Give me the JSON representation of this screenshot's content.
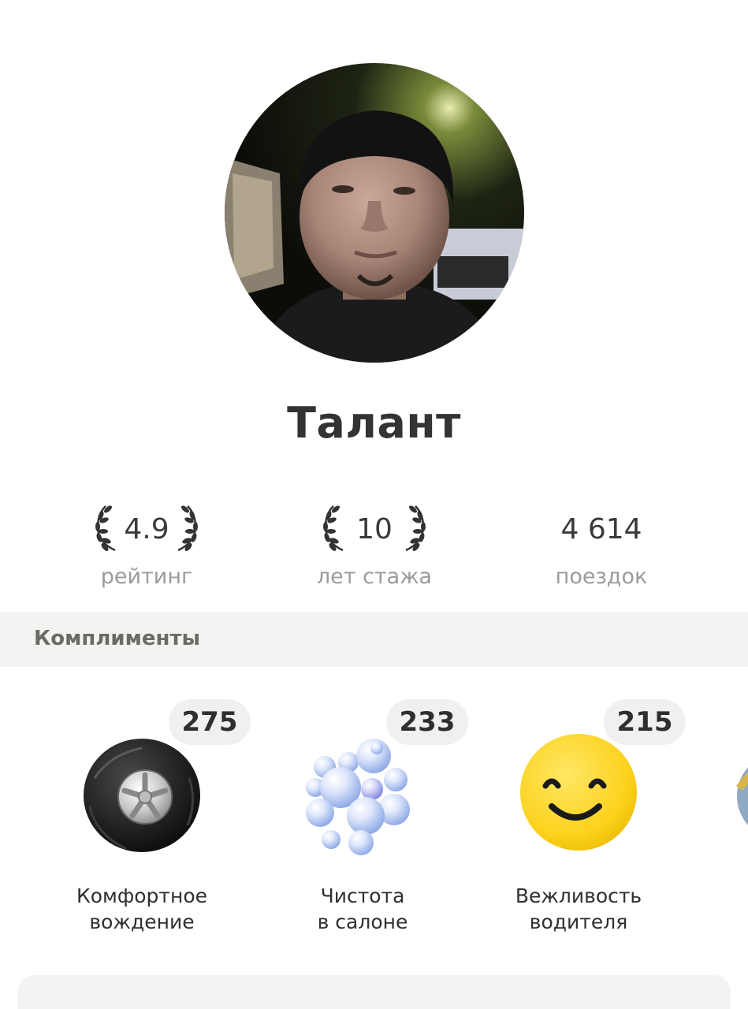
{
  "profile": {
    "name": "Талант",
    "avatar_icon": "driver-photo"
  },
  "stats": {
    "rating": {
      "value": "4.9",
      "label": "рейтинг"
    },
    "experience": {
      "value": "10",
      "label": "лет стажа"
    },
    "trips": {
      "value": "4 614",
      "label": "поездок"
    }
  },
  "compliments": {
    "title": "Комплименты",
    "items": [
      {
        "count": "275",
        "label_line1": "Комфортное",
        "label_line2": "вождение",
        "icon": "wheel-icon"
      },
      {
        "count": "233",
        "label_line1": "Чистота",
        "label_line2": "в салоне",
        "icon": "bubbles-icon"
      },
      {
        "count": "215",
        "label_line1": "Вежливость",
        "label_line2": "водителя",
        "icon": "smiley-icon"
      }
    ]
  },
  "colors": {
    "section_bg": "#f4f3f1",
    "badge_bg": "#f1f0ee",
    "smiley_yellow": "#fcd21c",
    "muted_text": "#9b9b9b"
  }
}
